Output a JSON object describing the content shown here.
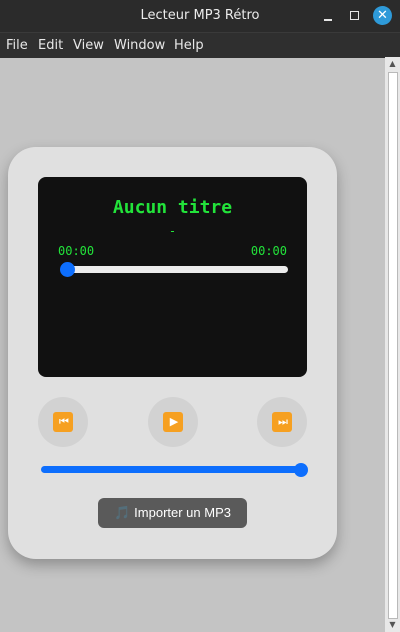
{
  "window": {
    "title": "Lecteur MP3 Rétro",
    "minimize_symbol": "",
    "maximize_symbol": "",
    "close_symbol": "✕"
  },
  "menu": {
    "items": [
      "File",
      "Edit",
      "View",
      "Window",
      "Help"
    ]
  },
  "player": {
    "title": "Aucun titre",
    "artist": "-",
    "current_time": "00:00",
    "duration": "00:00",
    "progress": 0,
    "volume": 1.0,
    "controls": {
      "prev_icon": "prev-track-icon",
      "play_icon": "play-icon",
      "next_icon": "next-track-icon",
      "prev_glyph": "⏮",
      "play_glyph": "▶",
      "next_glyph": "⏭"
    },
    "import_button": {
      "icon": "music-note-icon",
      "icon_glyph": "🎵",
      "label": "Importer un MP3"
    }
  },
  "colors": {
    "screen_text": "#22e33a",
    "accent": "#0d6efd",
    "control_icon": "#f6a021"
  }
}
